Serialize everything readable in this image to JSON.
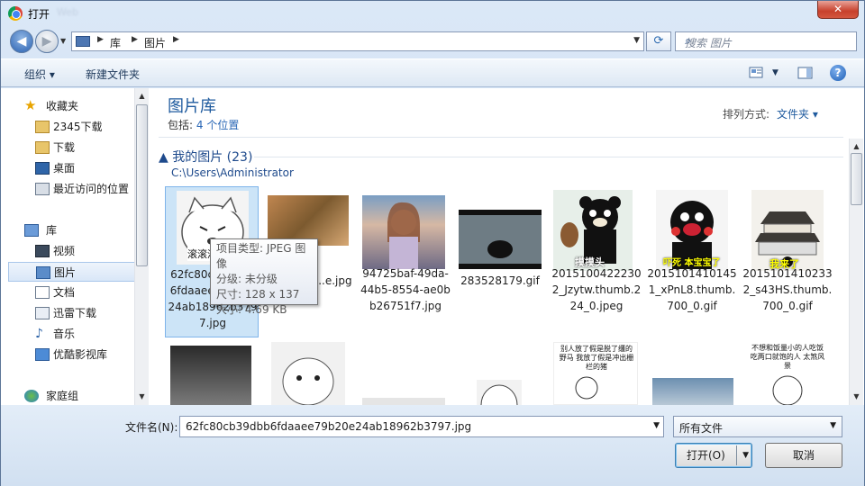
{
  "title": "打开",
  "title_blur": "Web",
  "close_glyph": "✕",
  "nav": {
    "back_glyph": "◀",
    "forward_glyph": "▶"
  },
  "address": {
    "crumbs": [
      "库",
      "图片"
    ],
    "separator": "▶"
  },
  "search_placeholder": "搜索 图片",
  "toolbar": {
    "organize": "组织 ▾",
    "new_folder": "新建文件夹",
    "help": "?"
  },
  "sidebar": {
    "items": [
      {
        "label": "收藏夹",
        "icon": "star-icon"
      },
      {
        "label": "2345下载",
        "icon": "folder-icon"
      },
      {
        "label": "下载",
        "icon": "folder-icon"
      },
      {
        "label": "桌面",
        "icon": "desktop-icon"
      },
      {
        "label": "最近访问的位置",
        "icon": "recent-icon"
      },
      {
        "label": "库",
        "icon": "library-icon"
      },
      {
        "label": "视频",
        "icon": "video-icon"
      },
      {
        "label": "图片",
        "icon": "picture-icon",
        "selected": true
      },
      {
        "label": "文档",
        "icon": "document-icon"
      },
      {
        "label": "迅雷下载",
        "icon": "download-icon"
      },
      {
        "label": "音乐",
        "icon": "music-icon"
      },
      {
        "label": "优酷影视库",
        "icon": "video-library-icon"
      },
      {
        "label": "家庭组",
        "icon": "homegroup-icon"
      }
    ]
  },
  "library": {
    "title": "图片库",
    "includes_label": "包括:",
    "includes_value": "4 个位置",
    "arrange_label": "排列方式:",
    "arrange_value": "文件夹 ▾"
  },
  "group": {
    "name": "▲ 我的图片 (23)",
    "path": "C:\\Users\\Administrator"
  },
  "files": [
    {
      "name": "62fc80cb39dbb6fdaaee79b20e24ab18962b3797.jpg",
      "thumb_text": "滚滚滚"
    },
    {
      "name": "...e.jpg",
      "thumb_text": ""
    },
    {
      "name": "94725baf-49da-44b5-8554-ae0bb26751f7.jpg",
      "thumb_text": ""
    },
    {
      "name": "283528179.gif",
      "thumb_text": ""
    },
    {
      "name": "20151004222302_Jzytw.thumb.224_0.jpeg",
      "thumb_text": "摸摸头"
    },
    {
      "name": "20151014101451_xPnL8.thumb.700_0.gif",
      "thumb_text": "吓死 本宝宝了"
    },
    {
      "name": "20151014102332_s43HS.thumb.700_0.gif",
      "thumb_text": "我来了"
    }
  ],
  "row2_texts": [
    "别人放了假是脱了缰的野马 我放了假是冲出栅栏的猪",
    "不想和饭量小的人吃饭 吃两口就饱的人 太煞风景"
  ],
  "tooltip": {
    "type": "项目类型: JPEG 图像",
    "rating": "分级: 未分级",
    "size_dims": "尺寸: 128 x 137",
    "filesize": "大小: 4.69 KB"
  },
  "filename": {
    "label": "文件名(N):",
    "value": "62fc80cb39dbb6fdaaee79b20e24ab18962b3797.jpg"
  },
  "filter": "所有文件",
  "buttons": {
    "open": "打开(O)",
    "cancel": "取消"
  },
  "colors": {
    "accent": "#1e5a9e",
    "selection": "#cce4f7",
    "close": "#c7402c"
  }
}
